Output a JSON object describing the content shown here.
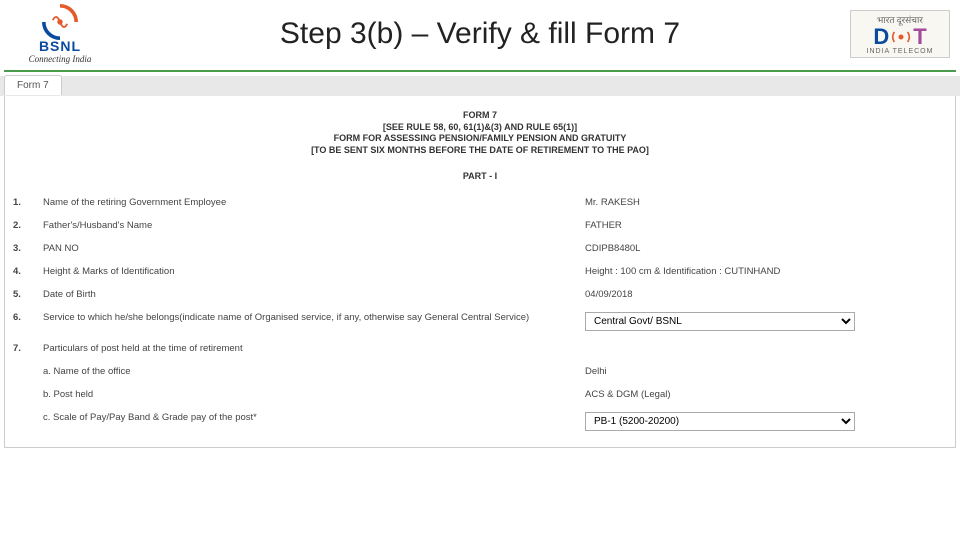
{
  "header": {
    "brand": "BSNL",
    "tagline": "Connecting India",
    "title": "Step 3(b) – Verify & fill Form 7",
    "dot_top": "भारत दूरसंचार",
    "dot_bottom": "INDIA TELECOM"
  },
  "tab": {
    "label": "Form 7"
  },
  "form": {
    "title": "FORM 7",
    "rule": "[SEE RULE 58, 60, 61(1)&(3) AND RULE 65(1)]",
    "desc": "FORM FOR ASSESSING PENSION/FAMILY PENSION AND GRATUITY",
    "note": "[TO BE SENT SIX MONTHS BEFORE THE DATE OF RETIREMENT TO THE PAO]",
    "part": "PART - I"
  },
  "rows": [
    {
      "n": "1.",
      "label": "Name of the retiring Government Employee",
      "value": "Mr. RAKESH",
      "type": "text"
    },
    {
      "n": "2.",
      "label": "Father's/Husband's Name",
      "value": "FATHER",
      "type": "text"
    },
    {
      "n": "3.",
      "label": "PAN NO",
      "value": "CDIPB8480L",
      "type": "text"
    },
    {
      "n": "4.",
      "label": "Height & Marks of Identification",
      "value": "Height : 100 cm & Identification : CUTINHAND",
      "type": "text"
    },
    {
      "n": "5.",
      "label": "Date of Birth",
      "value": "04/09/2018",
      "type": "text"
    },
    {
      "n": "6.",
      "label": "Service to which he/she belongs(indicate name of Organised service, if any, otherwise say General Central Service)",
      "value": "Central Govt/ BSNL",
      "type": "select",
      "options": [
        "Central Govt/ BSNL"
      ]
    },
    {
      "n": "7.",
      "label": "Particulars of post held at the time of retirement",
      "value": "",
      "type": "header"
    }
  ],
  "subrows": [
    {
      "n": "a.",
      "label": "Name of the office",
      "value": "Delhi",
      "type": "text"
    },
    {
      "n": "b.",
      "label": "Post held",
      "value": "ACS & DGM (Legal)",
      "type": "text"
    },
    {
      "n": "c.",
      "label": "Scale of Pay/Pay Band & Grade pay of the post*",
      "value": "PB-1 (5200-20200)",
      "type": "select",
      "options": [
        "PB-1 (5200-20200)"
      ]
    }
  ]
}
